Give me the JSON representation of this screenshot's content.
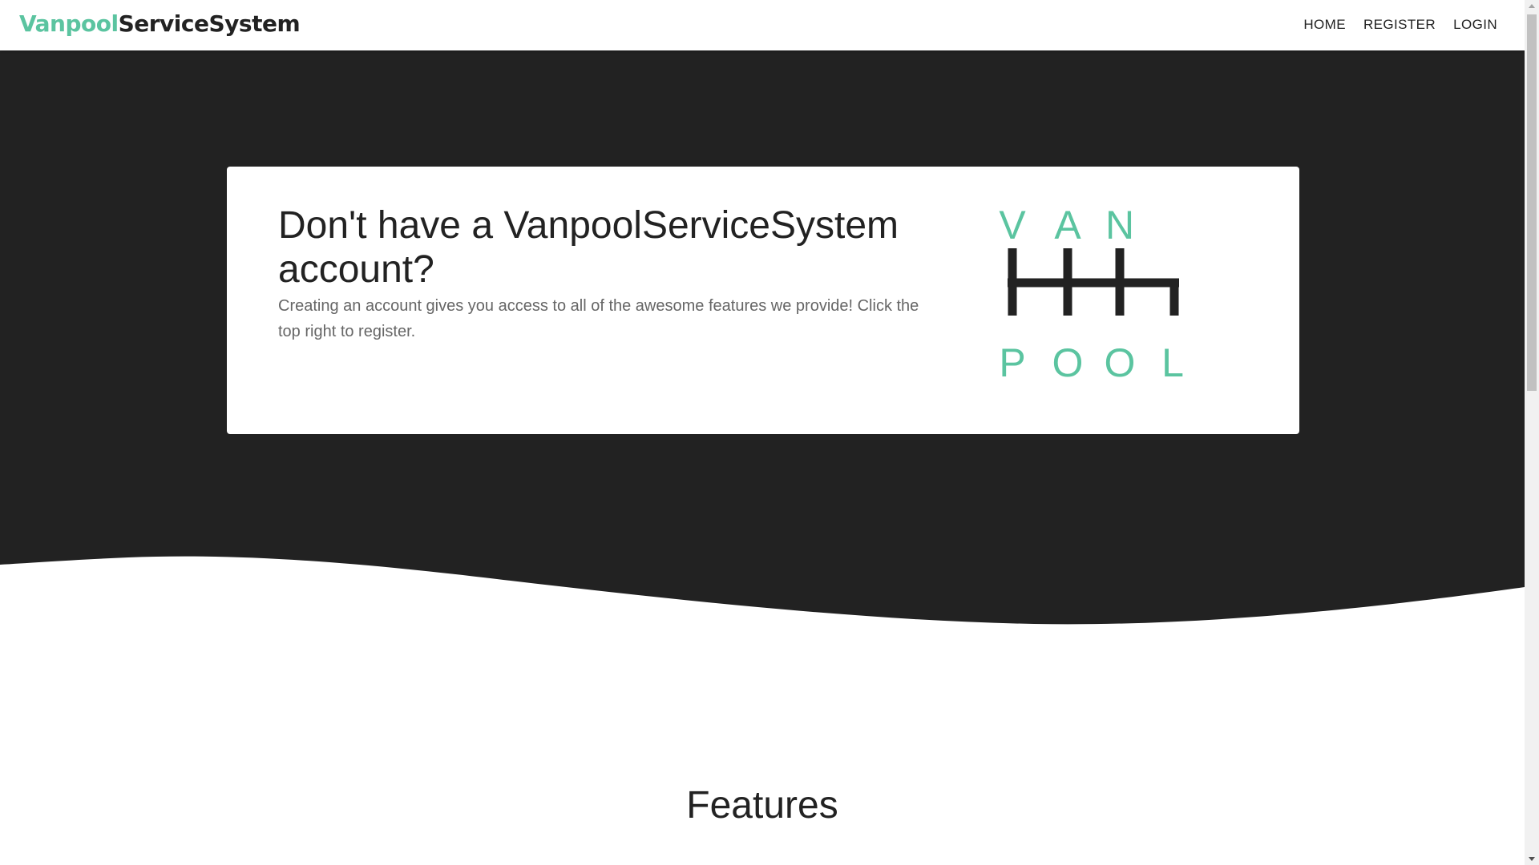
{
  "navbar": {
    "brand_primary": "Vanpool",
    "brand_secondary": "ServiceSystem",
    "links": [
      {
        "label": "HOME"
      },
      {
        "label": "REGISTER"
      },
      {
        "label": "LOGIN"
      }
    ]
  },
  "hero": {
    "title": "Don't have a VanpoolServiceSystem account?",
    "text": "Creating an account gives you access to all of the awesome features we provide! Click the top right to register.",
    "logo": {
      "top_letters": [
        "V",
        "A",
        "N"
      ],
      "bottom_letters": [
        "P",
        "O",
        "O",
        "L"
      ]
    }
  },
  "features": {
    "title": "Features"
  },
  "colors": {
    "accent": "#5bc4a0",
    "dark": "#222222",
    "body_text": "#666666"
  }
}
